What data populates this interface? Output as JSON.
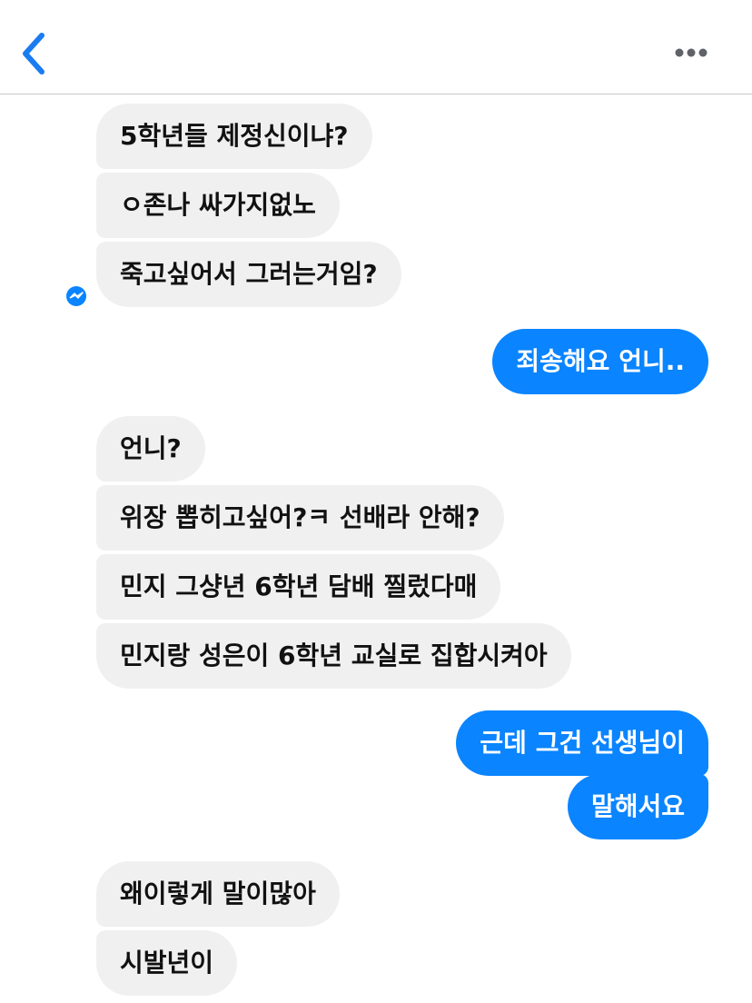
{
  "header": {
    "back_icon": "chevron-left-icon",
    "more_icon": "more-dots-icon",
    "accent": "#1a7cf0"
  },
  "colors": {
    "incoming_bubble": "#f0f0f0",
    "outgoing_bubble": "#0a84ff",
    "read_indicator": "#0a84ff"
  },
  "messages": [
    {
      "side": "in",
      "text": "5학년들 제정신이냐?"
    },
    {
      "side": "in",
      "text": "ㅇ존나 싸가지없노"
    },
    {
      "side": "in",
      "text": "죽고싶어서 그러는거임?"
    },
    {
      "side": "out",
      "text": "죄송해요 언니.."
    },
    {
      "side": "in",
      "text": "언니?"
    },
    {
      "side": "in",
      "text": "위장 뽑히고싶어?ㅋ 선배라 안해?"
    },
    {
      "side": "in",
      "text": "민지 그샹년 6학년 담배 찔렀다매"
    },
    {
      "side": "in",
      "text": "민지랑 성은이 6학년 교실로 집합시켜아"
    },
    {
      "side": "out",
      "text": "근데 그건 선생님이"
    },
    {
      "side": "out",
      "text": "말해서요"
    },
    {
      "side": "in",
      "text": "왜이렇게 말이많아"
    },
    {
      "side": "in",
      "text": "시발년이"
    }
  ],
  "read_indicator_icon": "messenger-icon"
}
